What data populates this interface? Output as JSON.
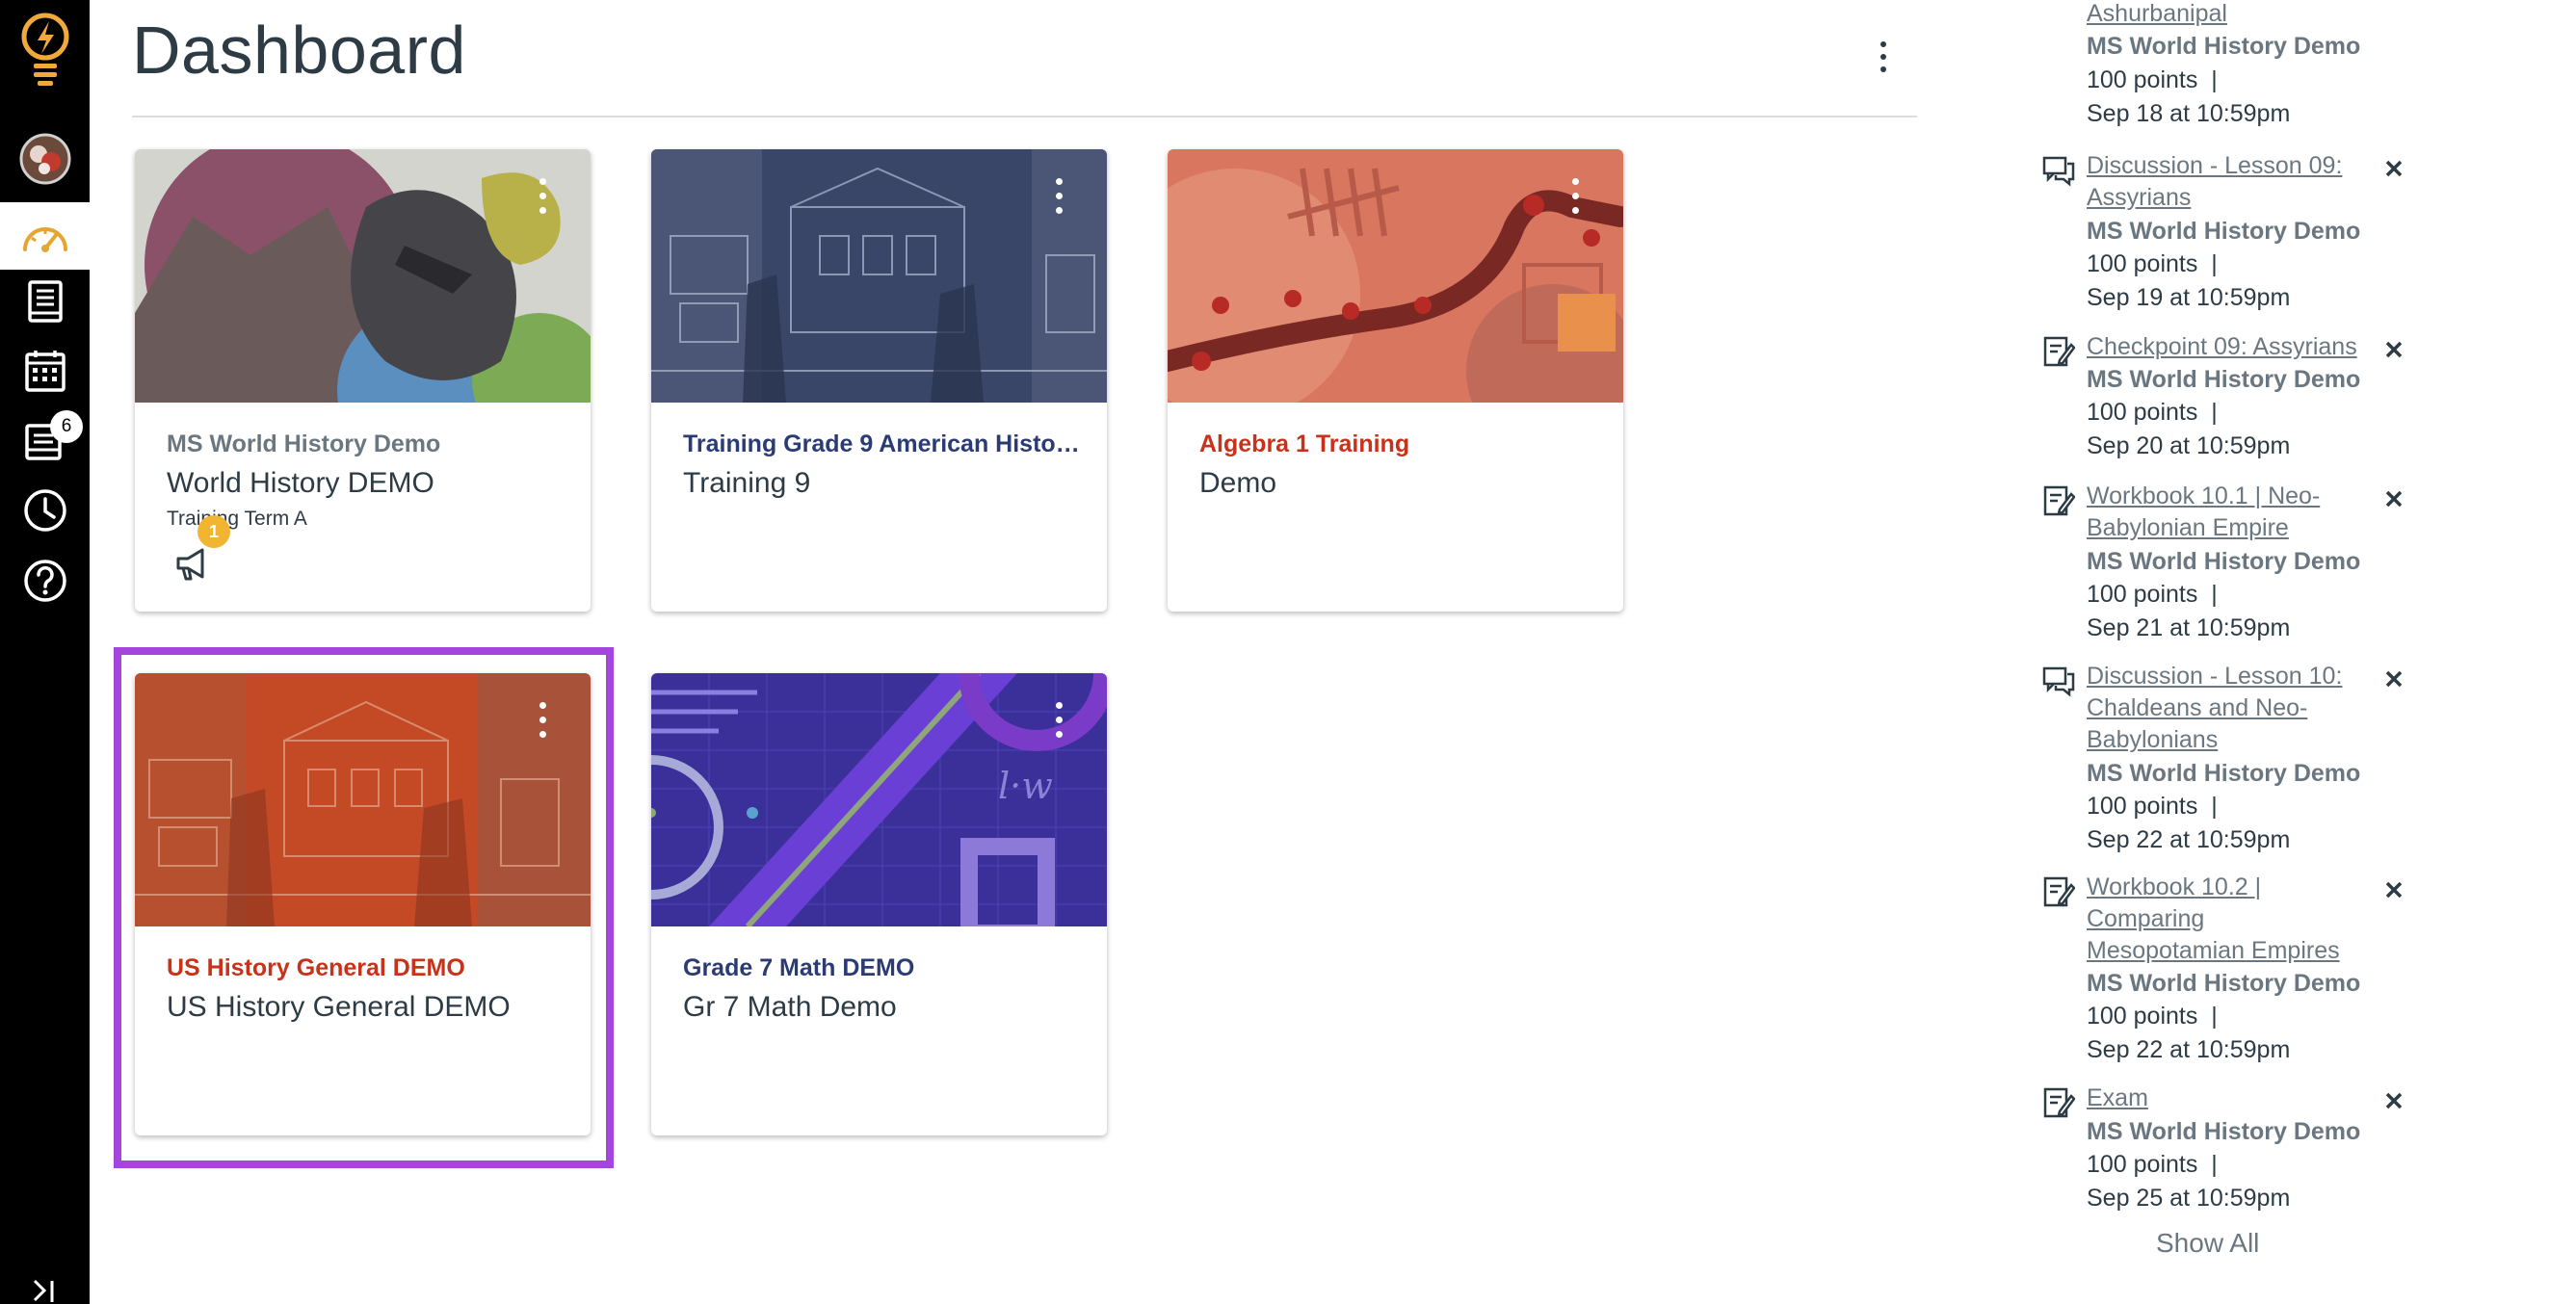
{
  "page": {
    "title": "Dashboard"
  },
  "nav": {
    "items": [
      {
        "name": "logo"
      },
      {
        "name": "account"
      },
      {
        "name": "dashboard"
      },
      {
        "name": "courses"
      },
      {
        "name": "calendar"
      },
      {
        "name": "inbox",
        "badge": "6"
      },
      {
        "name": "history"
      },
      {
        "name": "help"
      }
    ]
  },
  "cards": [
    {
      "code": "MS World History Demo",
      "name": "World History DEMO",
      "term": "Training Term A",
      "announcements": "1",
      "code_color": "#6b7780"
    },
    {
      "code": "Training Grade 9 American History…",
      "name": "Training 9",
      "term": "",
      "code_color": "#2a3c73"
    },
    {
      "code": "Algebra 1 Training",
      "name": "Demo",
      "term": "",
      "code_color": "#c8321b"
    },
    {
      "code": "US History General DEMO",
      "name": "US History General DEMO",
      "term": "",
      "code_color": "#c8321b"
    },
    {
      "code": "Grade 7 Math DEMO",
      "name": "Gr 7 Math Demo",
      "term": "",
      "code_color": "#2a3c73"
    }
  ],
  "todo": {
    "items": [
      {
        "icon": "assignment-icon",
        "title": "Ashurbanipal",
        "course": "MS World History Demo",
        "points": "100 points  |",
        "date": "Sep 18 at 10:59pm"
      },
      {
        "icon": "discussion-icon",
        "title": "Discussion - Lesson 09: Assyrians",
        "course": "MS World History Demo",
        "points": "100 points  |",
        "date": "Sep 19 at 10:59pm"
      },
      {
        "icon": "assignment-icon",
        "title": "Checkpoint 09: Assyrians",
        "course": "MS World History Demo",
        "points": "100 points  |",
        "date": "Sep 20 at 10:59pm"
      },
      {
        "icon": "assignment-icon",
        "title": "Workbook 10.1 | Neo-Babylonian Empire",
        "course": "MS World History Demo",
        "points": "100 points  |",
        "date": "Sep 21 at 10:59pm"
      },
      {
        "icon": "discussion-icon",
        "title": "Discussion - Lesson 10: Chaldeans and Neo-Babylonians",
        "course": "MS World History Demo",
        "points": "100 points  |",
        "date": "Sep 22 at 10:59pm"
      },
      {
        "icon": "assignment-icon",
        "title": "Workbook 10.2 | Comparing Mesopotamian Empires",
        "course": "MS World History Demo",
        "points": "100 points  |",
        "date": "Sep 22 at 10:59pm"
      },
      {
        "icon": "assignment-icon",
        "title": "Exam",
        "course": "MS World History Demo",
        "points": "100 points  |",
        "date": "Sep 25 at 10:59pm"
      }
    ],
    "show_all": "Show All"
  }
}
